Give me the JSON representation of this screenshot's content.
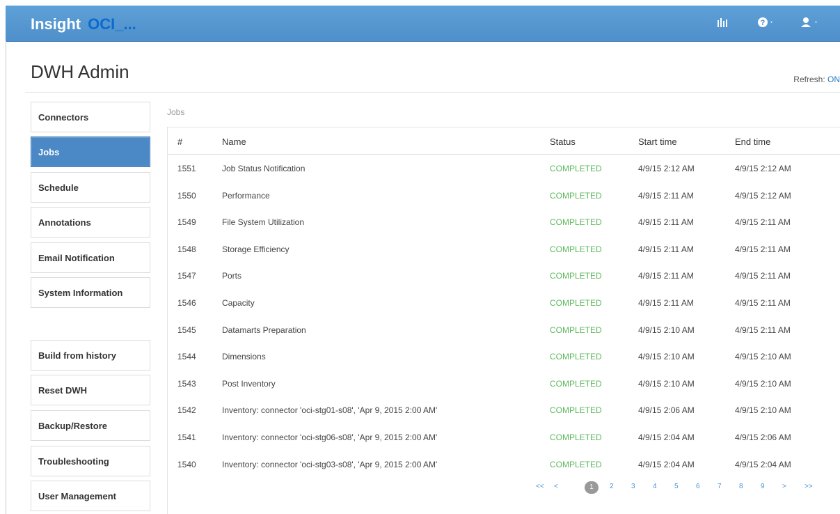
{
  "header": {
    "brand": "Insight",
    "instance": "OCI_...",
    "icons": [
      "bar-chart-icon",
      "help-icon",
      "user-icon"
    ]
  },
  "page": {
    "title": "DWH Admin",
    "refresh_label": "Refresh:",
    "refresh_value": "ON"
  },
  "sidebar": {
    "items": [
      {
        "label": "Connectors"
      },
      {
        "label": "Jobs",
        "active": true
      },
      {
        "label": "Schedule"
      },
      {
        "label": "Annotations"
      },
      {
        "label": "Email Notification"
      },
      {
        "label": "System Information"
      },
      {
        "label": "Build from history"
      },
      {
        "label": "Reset DWH"
      },
      {
        "label": "Backup/Restore"
      },
      {
        "label": "Troubleshooting"
      },
      {
        "label": "User Management"
      }
    ]
  },
  "jobs": {
    "panel_label": "Jobs",
    "columns": [
      "#",
      "Name",
      "Status",
      "Start time",
      "End time"
    ],
    "rows": [
      {
        "id": "1551",
        "name": "Job Status Notification",
        "status": "COMPLETED",
        "start": "4/9/15 2:12 AM",
        "end": "4/9/15 2:12 AM"
      },
      {
        "id": "1550",
        "name": "Performance",
        "status": "COMPLETED",
        "start": "4/9/15 2:11 AM",
        "end": "4/9/15 2:12 AM"
      },
      {
        "id": "1549",
        "name": "File System Utilization",
        "status": "COMPLETED",
        "start": "4/9/15 2:11 AM",
        "end": "4/9/15 2:11 AM"
      },
      {
        "id": "1548",
        "name": "Storage Efficiency",
        "status": "COMPLETED",
        "start": "4/9/15 2:11 AM",
        "end": "4/9/15 2:11 AM"
      },
      {
        "id": "1547",
        "name": "Ports",
        "status": "COMPLETED",
        "start": "4/9/15 2:11 AM",
        "end": "4/9/15 2:11 AM"
      },
      {
        "id": "1546",
        "name": "Capacity",
        "status": "COMPLETED",
        "start": "4/9/15 2:11 AM",
        "end": "4/9/15 2:11 AM"
      },
      {
        "id": "1545",
        "name": "Datamarts Preparation",
        "status": "COMPLETED",
        "start": "4/9/15 2:10 AM",
        "end": "4/9/15 2:11 AM"
      },
      {
        "id": "1544",
        "name": "Dimensions",
        "status": "COMPLETED",
        "start": "4/9/15 2:10 AM",
        "end": "4/9/15 2:10 AM"
      },
      {
        "id": "1543",
        "name": "Post Inventory",
        "status": "COMPLETED",
        "start": "4/9/15 2:10 AM",
        "end": "4/9/15 2:10 AM"
      },
      {
        "id": "1542",
        "name": "Inventory: connector 'oci-stg01-s08', 'Apr 9, 2015 2:00 AM'",
        "status": "COMPLETED",
        "start": "4/9/15 2:06 AM",
        "end": "4/9/15 2:10 AM"
      },
      {
        "id": "1541",
        "name": "Inventory: connector 'oci-stg06-s08', 'Apr 9, 2015 2:00 AM'",
        "status": "COMPLETED",
        "start": "4/9/15 2:04 AM",
        "end": "4/9/15 2:06 AM"
      },
      {
        "id": "1540",
        "name": "Inventory: connector 'oci-stg03-s08', 'Apr 9, 2015 2:00 AM'",
        "status": "COMPLETED",
        "start": "4/9/15 2:04 AM",
        "end": "4/9/15 2:04 AM"
      }
    ]
  },
  "pagination": {
    "items": [
      "<<",
      "<",
      "1",
      "2",
      "3",
      "4",
      "5",
      "6",
      "7",
      "8",
      "9",
      ">",
      ">>"
    ],
    "current": "1"
  },
  "colors": {
    "header_bg": "#5b9bd5",
    "instance_text": "#0b6bd1",
    "active_nav": "#4b88c6",
    "status_completed": "#5cb85c",
    "pager_link": "#4a90d9"
  }
}
